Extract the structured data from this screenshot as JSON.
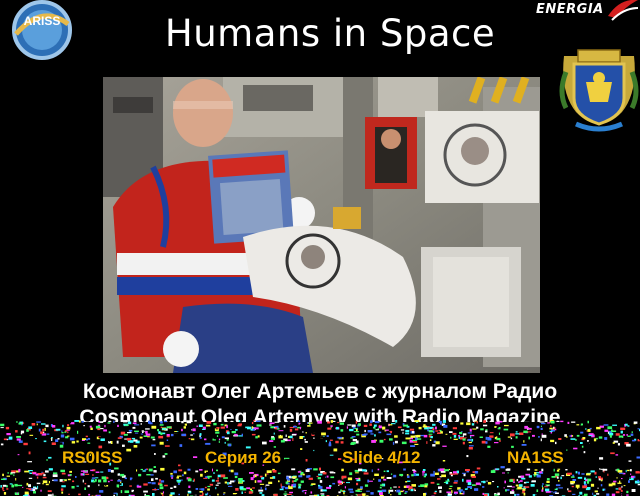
{
  "title": "Humans in Space",
  "logos": {
    "ariss": "ARISS",
    "energia": "ENERGIA"
  },
  "caption": {
    "russian": "Космонавт Олег Артемьев с журналом Радио",
    "english": "Cosmonaut Oleg Artemyev with Radio Magazine"
  },
  "footer": {
    "callsign": "RS0ISS",
    "series": "Серия 26",
    "slide": "Slide 4/12",
    "callsign_right": "NA1SS"
  },
  "colors": {
    "background": "#000000",
    "title": "#ffffff",
    "footer": "#f4b400"
  }
}
